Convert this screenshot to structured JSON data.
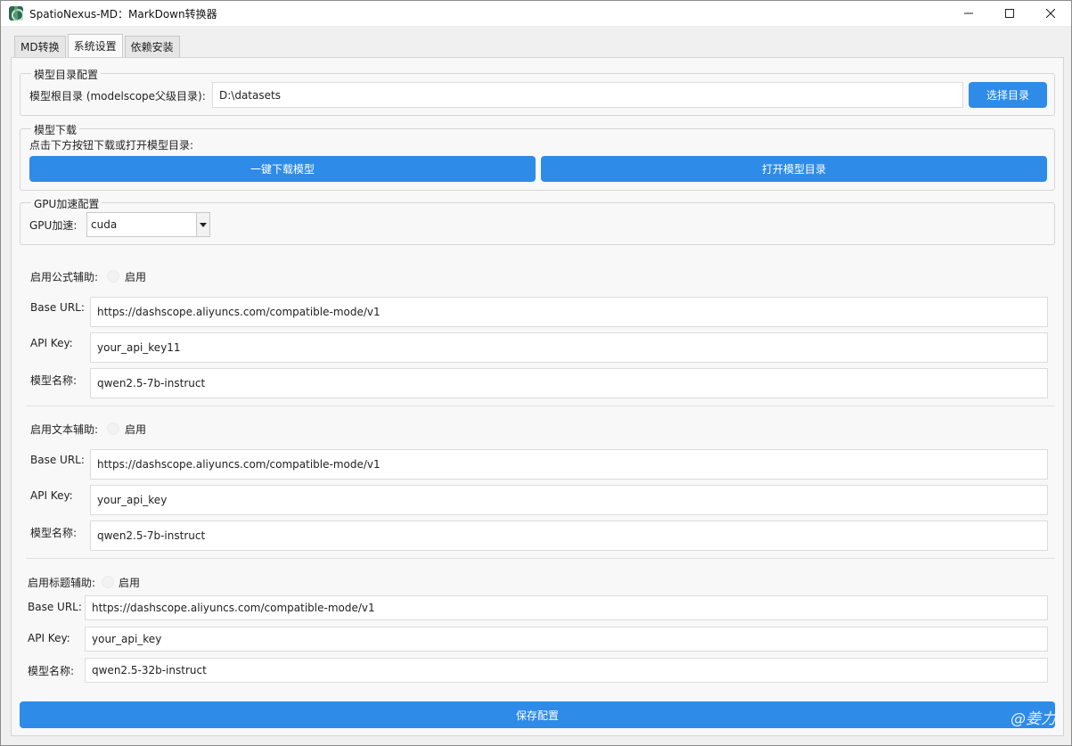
{
  "window": {
    "title": "SpatioNexus-MD：MarkDown转换器",
    "minimize_icon": "minimize-icon",
    "maximize_icon": "maximize-icon",
    "close_icon": "close-icon"
  },
  "tabs": [
    {
      "label": "MD转换",
      "active": false
    },
    {
      "label": "系统设置",
      "active": true
    },
    {
      "label": "依赖安装",
      "active": false
    }
  ],
  "model_dir": {
    "title": "模型目录配置",
    "label": "模型根目录 (modelscope父级目录):",
    "value": "D:\\datasets",
    "button": "选择目录"
  },
  "model_download": {
    "title": "模型下载",
    "hint": "点击下方按钮下载或打开模型目录:",
    "download_button": "一键下载模型",
    "open_button": "打开模型目录"
  },
  "gpu": {
    "title": "GPU加速配置",
    "label": "GPU加速:",
    "selected": "cuda"
  },
  "formula": {
    "label": "启用公式辅助:",
    "toggle_label": "启用",
    "base_url_label": "Base URL:",
    "base_url": "https://dashscope.aliyuncs.com/compatible-mode/v1",
    "api_key_label": "API Key:",
    "api_key": "your_api_key11",
    "model_label": "模型名称:",
    "model": "qwen2.5-7b-instruct"
  },
  "text": {
    "label": "启用文本辅助:",
    "toggle_label": "启用",
    "base_url_label": "Base URL:",
    "base_url": "https://dashscope.aliyuncs.com/compatible-mode/v1",
    "api_key_label": "API Key:",
    "api_key": "your_api_key",
    "model_label": "模型名称:",
    "model": "qwen2.5-7b-instruct"
  },
  "heading": {
    "label": "启用标题辅助:",
    "toggle_label": "启用",
    "base_url_label": "Base URL:",
    "base_url": "https://dashscope.aliyuncs.com/compatible-mode/v1",
    "api_key_label": "API Key:",
    "api_key": "your_api_key",
    "model_label": "模型名称:",
    "model": "qwen2.5-32b-instruct"
  },
  "save_button": "保存配置",
  "watermark": "@姜力",
  "colors": {
    "accent": "#2e8be8",
    "background": "#f0f0f0"
  }
}
